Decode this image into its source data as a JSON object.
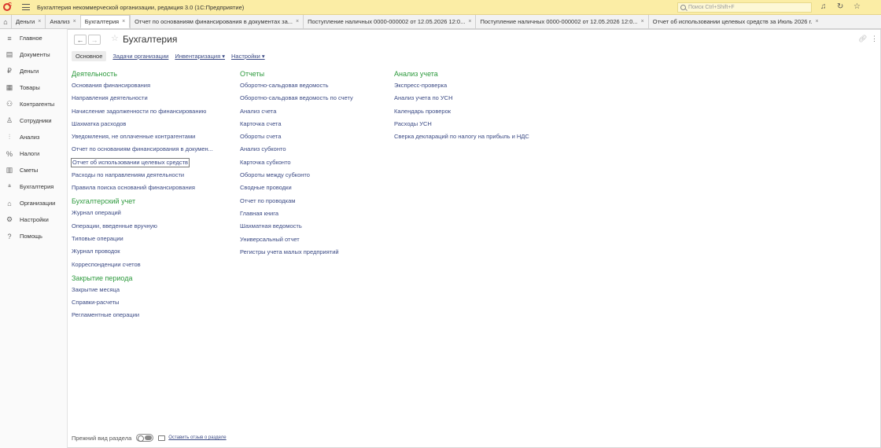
{
  "titlebar": {
    "title": "Бухгалтерия некоммерческой организации, редакция 3.0  (1С:Предприятие)",
    "search_placeholder": "Поиск Ctrl+Shift+F"
  },
  "tabs": [
    {
      "label": "Деньги"
    },
    {
      "label": "Анализ"
    },
    {
      "label": "Бухгалтерия"
    },
    {
      "label": "Отчет по основаниям финансирования в документах за..."
    },
    {
      "label": "Поступление наличных 0000-000002 от 12.05.2026 12:0..."
    },
    {
      "label": "Поступление наличных 0000-000002 от 12.05.2026 12:0..."
    },
    {
      "label": "Отчет об использовании целевых средств за Июль 2026 г."
    }
  ],
  "sidebar": {
    "items": [
      {
        "label": "Главное",
        "icon": "≡"
      },
      {
        "label": "Документы",
        "icon": "▤"
      },
      {
        "label": "Деньги",
        "icon": "₽"
      },
      {
        "label": "Товары",
        "icon": "▦"
      },
      {
        "label": "Контрагенты",
        "icon": "⚇"
      },
      {
        "label": "Сотрудники",
        "icon": "♙"
      },
      {
        "label": "Анализ",
        "icon": "⫶"
      },
      {
        "label": "Налоги",
        "icon": "%"
      },
      {
        "label": "Сметы",
        "icon": "▥"
      },
      {
        "label": "Бухгалтерия",
        "icon": "ª"
      },
      {
        "label": "Организации",
        "icon": "⌂"
      },
      {
        "label": "Настройки",
        "icon": "⚙"
      },
      {
        "label": "Помощь",
        "icon": "?"
      }
    ]
  },
  "page": {
    "title": "Бухгалтерия",
    "subtabs": [
      "Основное",
      "Задачи организации",
      "Инвентаризация ▾",
      "Настройки ▾"
    ]
  },
  "col1": {
    "groups": [
      {
        "header": "Деятельность",
        "links": [
          "Основания финансирования",
          "Направления деятельности",
          "Начисление задолженности по финансированию",
          "Шахматка расходов",
          "Уведомления, не оплаченные контрагентами",
          "Отчет по основаниям финансирования в докумен...",
          "Отчет об использовании целевых средств",
          "Расходы по направлениям деятельности",
          "Правила поиска оснований финансирования"
        ]
      },
      {
        "header": "Бухгалтерский учет",
        "links": [
          "Журнал операций",
          "Операции, введенные вручную",
          "Типовые операции",
          "Журнал проводок",
          "Корреспонденции счетов"
        ]
      },
      {
        "header": "Закрытие периода",
        "links": [
          "Закрытие месяца",
          "Справки-расчеты",
          "Регламентные операции"
        ]
      }
    ]
  },
  "col2": {
    "header": "Отчеты",
    "links": [
      "Оборотно-сальдовая ведомость",
      "Оборотно-сальдовая ведомость по счету",
      "Анализ счета",
      "Карточка счета",
      "Обороты счета",
      "Анализ субконто",
      "Карточка субконто",
      "Обороты между субконто",
      "Сводные проводки",
      "Отчет по проводкам",
      "Главная книга",
      "Шахматная ведомость",
      "Универсальный отчет",
      "Регистры учета малых предприятий"
    ]
  },
  "col3": {
    "header": "Анализ учета",
    "links": [
      "Экспресс-проверка",
      "Анализ учета по УСН",
      "Календарь проверок",
      "Расходы УСН",
      "Сверка деклараций по налогу на прибыль и НДС"
    ]
  },
  "footer": {
    "old_view_label": "Прежний вид раздела",
    "feedback_link": "Оставить отзыв о разделе"
  }
}
